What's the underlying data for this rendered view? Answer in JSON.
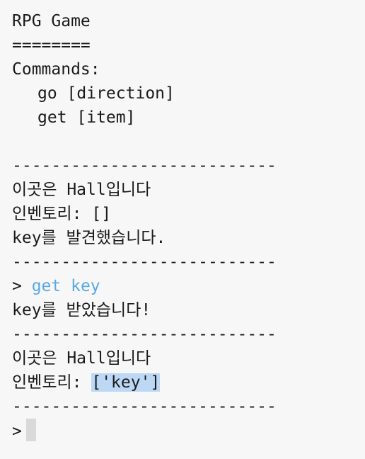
{
  "title": "RPG Game",
  "title_underline": "========",
  "commands_header": "Commands:",
  "commands": [
    "go [direction]",
    "get [item]"
  ],
  "separator": "---------------------------",
  "blocks": [
    {
      "location": "이곳은 Hall입니다",
      "inventory_label": "인벤토리: ",
      "inventory_value": "[]",
      "message": "key를 발견했습니다."
    },
    {
      "location": "이곳은 Hall입니다",
      "inventory_label": "인벤토리: ",
      "inventory_value": "['key']"
    }
  ],
  "prompt": {
    "symbol": "> ",
    "entered_command": "get key",
    "result": "key를 받았습니다!"
  },
  "active_prompt": ">"
}
